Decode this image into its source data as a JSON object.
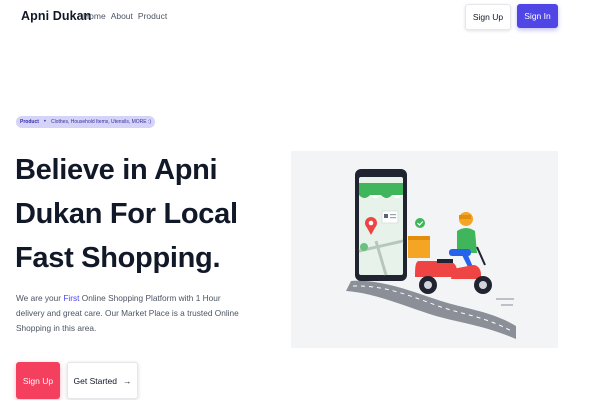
{
  "nav": {
    "brand": "Apni Dukan",
    "links": [
      "Home",
      "About",
      "Product"
    ],
    "signup_label": "Sign Up",
    "signin_label": "Sign In"
  },
  "hero": {
    "pill": {
      "tag": "Product",
      "dot": "•",
      "text": "Clothes, Household Items, Utensils, MORE :)"
    },
    "title": "Believe in Apni Dukan For Local Fast Shopping.",
    "description": {
      "before": "We are your ",
      "highlight": "First",
      "after": " Online Shopping Platform with 1 Hour delivery and great care. Our Market Place is a trusted Online Shopping in this area."
    },
    "signup_label": "Sign Up",
    "get_started_label": "Get Started",
    "arrow": "→"
  },
  "colors": {
    "primary": "#4f46e5",
    "accent": "#f43f5e",
    "pill_bg": "#d5d3f7"
  }
}
